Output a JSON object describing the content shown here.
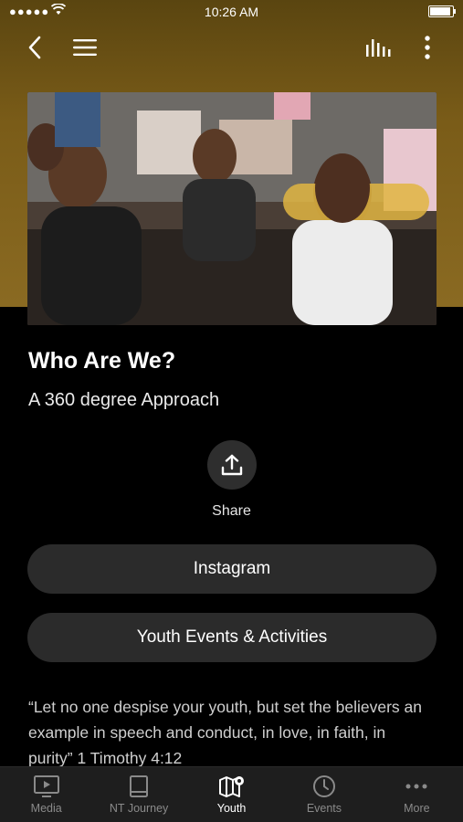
{
  "status": {
    "signal": "●●●●●",
    "time": "10:26 AM"
  },
  "nav": {
    "icons": [
      "back-icon",
      "hamburger-menu-icon",
      "equalizer-icon",
      "more-vertical-icon"
    ]
  },
  "colors": {
    "header_gradient": "#7a5c18",
    "pill_bg": "#2b2b2b",
    "tab_active": "#ffffff",
    "tab_inactive": "#8a8a8a"
  },
  "content": {
    "title": "Who Are We?",
    "subtitle": "A 360 degree Approach",
    "share_label": "Share",
    "buttons": [
      {
        "label": "Instagram"
      },
      {
        "label": "Youth Events & Activities"
      }
    ],
    "verse": "“Let no one despise your youth, but set the believers an example in speech and conduct, in love, in faith, in purity” 1 Timothy 4:12"
  },
  "tabs": [
    {
      "label": "Media",
      "icon": "tv-play-icon",
      "active": false
    },
    {
      "label": "NT Journey",
      "icon": "book-icon",
      "active": false
    },
    {
      "label": "Youth",
      "icon": "map-pin-icon",
      "active": true
    },
    {
      "label": "Events",
      "icon": "clock-icon",
      "active": false
    },
    {
      "label": "More",
      "icon": "dots-icon",
      "active": false
    }
  ]
}
